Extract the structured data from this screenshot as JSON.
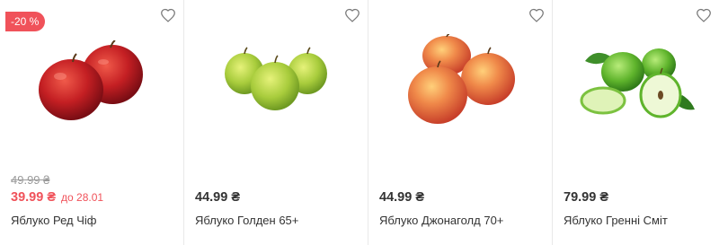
{
  "colors": {
    "accent": "#f0525a",
    "text": "#333333",
    "muted": "#9a9a9a"
  },
  "products": [
    {
      "discount_badge": "-20 %",
      "image_icon": "red-apples-image",
      "old_price": "49.99 ₴",
      "price": "39.99 ₴",
      "sale_until": "до 28.01",
      "name": "Яблуко Ред Чіф"
    },
    {
      "image_icon": "golden-apples-image",
      "price": "44.99 ₴",
      "name": "Яблуко Голден 65+"
    },
    {
      "image_icon": "jonagold-apples-image",
      "price": "44.99 ₴",
      "name": "Яблуко Джонаголд 70+"
    },
    {
      "image_icon": "granny-smith-apples-image",
      "price": "79.99 ₴",
      "name": "Яблуко Гренні Сміт"
    }
  ]
}
